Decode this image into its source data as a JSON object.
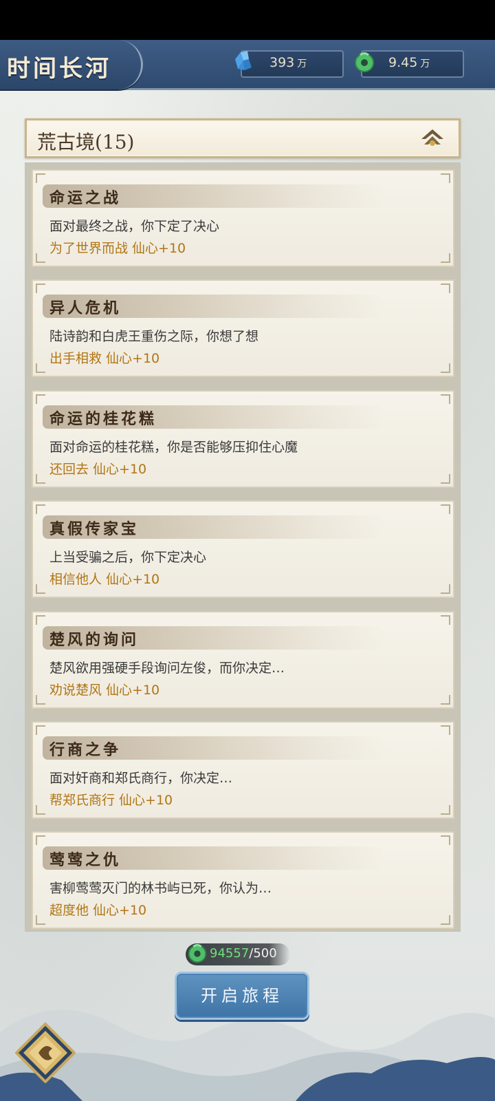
{
  "header": {
    "title": "时间长河",
    "currencies": [
      {
        "icon": "blue-crystal-icon",
        "value": "393",
        "unit": "万"
      },
      {
        "icon": "jade-coin-icon",
        "value": "9.45",
        "unit": "万"
      }
    ]
  },
  "realm": {
    "title": "荒古境(15)",
    "toggle_icon": "collapse-arrow-icon"
  },
  "events": [
    {
      "title": "命运之战",
      "desc": "面对最终之战，你下定了决心",
      "choice": "为了世界而战  仙心+10"
    },
    {
      "title": "异人危机",
      "desc": "陆诗韵和白虎王重伤之际，你想了想",
      "choice": "出手相救  仙心+10"
    },
    {
      "title": "命运的桂花糕",
      "desc": "面对命运的桂花糕，你是否能够压抑住心魔",
      "choice": "还回去  仙心+10"
    },
    {
      "title": "真假传家宝",
      "desc": "上当受骗之后，你下定决心",
      "choice": "相信他人  仙心+10"
    },
    {
      "title": "楚风的询问",
      "desc": "楚风欲用强硬手段询问左俊，而你决定…",
      "choice": "劝说楚风  仙心+10"
    },
    {
      "title": "行商之争",
      "desc": "面对奸商和郑氏商行，你决定…",
      "choice": "帮郑氏商行  仙心+10"
    },
    {
      "title": "莺莺之仇",
      "desc": "害柳莺莺灭门的林书屿已死，你认为…",
      "choice": "超度他  仙心+10"
    }
  ],
  "cost": {
    "have": "94557",
    "need": "/500"
  },
  "start_button": {
    "label": "开启旅程"
  },
  "colors": {
    "header": "#3f5d85",
    "choice": "#b27514",
    "button": "#4e83b3"
  }
}
